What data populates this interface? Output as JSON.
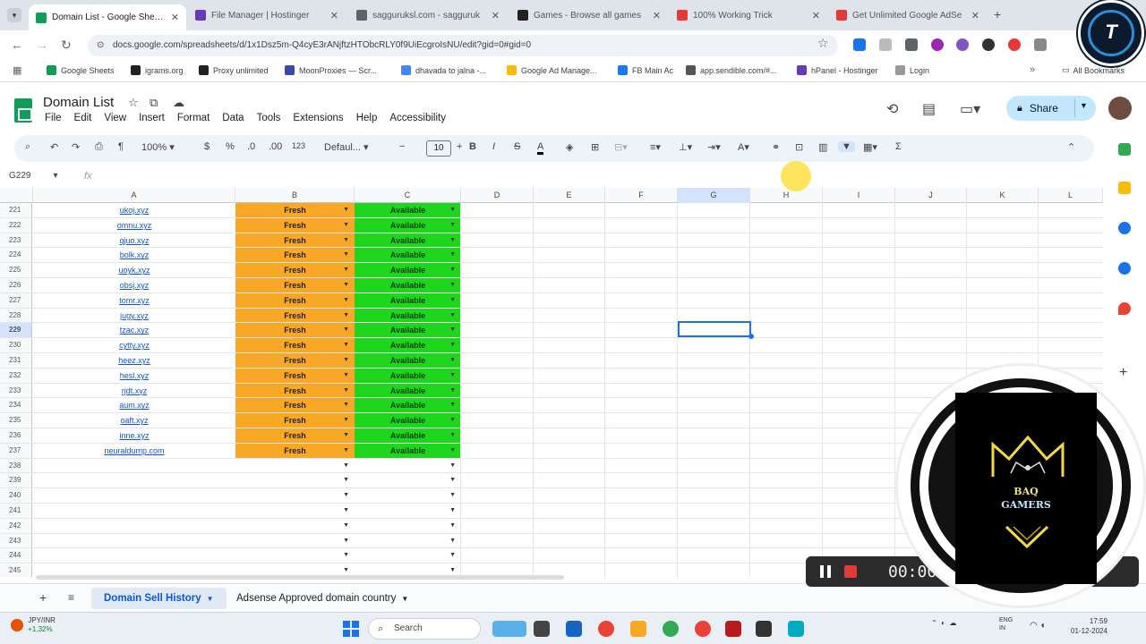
{
  "browser": {
    "tabs": [
      {
        "title": "Domain List - Google Sheets",
        "color": "#0f9d58",
        "active": true
      },
      {
        "title": "File Manager | Hostinger",
        "color": "#673ab7",
        "active": false
      },
      {
        "title": "sagguruksl.com - sagguruk",
        "color": "#5f6368",
        "active": false
      },
      {
        "title": "Games - Browse all games",
        "color": "#222222",
        "active": false
      },
      {
        "title": "100% Working Trick",
        "color": "#e53935",
        "active": false
      },
      {
        "title": "Get Unlimited Google AdSe",
        "color": "#e53935",
        "active": false
      }
    ],
    "url": "docs.google.com/spreadsheets/d/1x1Dsz5m-Q4cyE3rANjftzHTObcRLY0f9UiEcgroIsNU/edit?gid=0#gid=0",
    "bookmarks": [
      {
        "label": "Google Sheets",
        "color": "#0f9d58"
      },
      {
        "label": "igrams.org",
        "color": "#222222"
      },
      {
        "label": "Proxy unlimited",
        "color": "#222222"
      },
      {
        "label": "MoonProxies — Scr...",
        "color": "#3949ab"
      },
      {
        "label": "dhavada to jalna -...",
        "color": "#4285f4"
      },
      {
        "label": "Google Ad Manage...",
        "color": "#fbbc04"
      },
      {
        "label": "FB Main Ac",
        "color": "#1877f2"
      },
      {
        "label": "app.sendible.com/#...",
        "color": "#555555"
      },
      {
        "label": "hPanel - Hostinger",
        "color": "#673ab7"
      },
      {
        "label": "Login",
        "color": "#999999"
      }
    ],
    "all_bookmarks": "All Bookmarks"
  },
  "sheets": {
    "title": "Domain List",
    "menu": [
      "File",
      "Edit",
      "View",
      "Insert",
      "Format",
      "Data",
      "Tools",
      "Extensions",
      "Help",
      "Accessibility"
    ],
    "share_label": "Share",
    "toolbar": {
      "zoom": "100%",
      "currency": "$",
      "percent": "%",
      "dec_dec": ".0",
      "dec_inc": ".00",
      "num_fmt": "123",
      "font": "Defaul...",
      "font_size": "10"
    },
    "name_box": "G229",
    "fx": "fx",
    "columns": [
      "A",
      "B",
      "C",
      "D",
      "E",
      "F",
      "G",
      "H",
      "I",
      "J",
      "K",
      "L"
    ],
    "selected_column": "G",
    "selected_row": "229",
    "rows": [
      {
        "num": "221",
        "domain": "ukoj.xyz",
        "status": "Fresh",
        "avail": "Available"
      },
      {
        "num": "222",
        "domain": "omnu.xyz",
        "status": "Fresh",
        "avail": "Available"
      },
      {
        "num": "223",
        "domain": "qjuo.xyz",
        "status": "Fresh",
        "avail": "Available"
      },
      {
        "num": "224",
        "domain": "bolk.xyz",
        "status": "Fresh",
        "avail": "Available"
      },
      {
        "num": "225",
        "domain": "uoyk.xyz",
        "status": "Fresh",
        "avail": "Available"
      },
      {
        "num": "226",
        "domain": "obsj.xyz",
        "status": "Fresh",
        "avail": "Available"
      },
      {
        "num": "227",
        "domain": "tomr.xyz",
        "status": "Fresh",
        "avail": "Available"
      },
      {
        "num": "228",
        "domain": "jugy.xyz",
        "status": "Fresh",
        "avail": "Available"
      },
      {
        "num": "229",
        "domain": "tzac.xyz",
        "status": "Fresh",
        "avail": "Available"
      },
      {
        "num": "230",
        "domain": "cytty.xyz",
        "status": "Fresh",
        "avail": "Available"
      },
      {
        "num": "231",
        "domain": "heez.xyz",
        "status": "Fresh",
        "avail": "Available"
      },
      {
        "num": "232",
        "domain": "hesl.xyz",
        "status": "Fresh",
        "avail": "Available"
      },
      {
        "num": "233",
        "domain": "rjdt.xyz",
        "status": "Fresh",
        "avail": "Available"
      },
      {
        "num": "234",
        "domain": "aum.xyz",
        "status": "Fresh",
        "avail": "Available"
      },
      {
        "num": "235",
        "domain": "oaft.xyz",
        "status": "Fresh",
        "avail": "Available"
      },
      {
        "num": "236",
        "domain": "inne.xyz",
        "status": "Fresh",
        "avail": "Available"
      },
      {
        "num": "237",
        "domain": "neuraldump.com",
        "status": "Fresh",
        "avail": "Available"
      },
      {
        "num": "238",
        "domain": "",
        "status": "",
        "avail": ""
      },
      {
        "num": "239",
        "domain": "",
        "status": "",
        "avail": ""
      },
      {
        "num": "240",
        "domain": "",
        "status": "",
        "avail": ""
      },
      {
        "num": "241",
        "domain": "",
        "status": "",
        "avail": ""
      },
      {
        "num": "242",
        "domain": "",
        "status": "",
        "avail": ""
      },
      {
        "num": "243",
        "domain": "",
        "status": "",
        "avail": ""
      },
      {
        "num": "244",
        "domain": "",
        "status": "",
        "avail": ""
      },
      {
        "num": "245",
        "domain": "",
        "status": "",
        "avail": ""
      }
    ],
    "sheet_tabs": [
      {
        "label": "Domain Sell History",
        "active": true
      },
      {
        "label": "Adsense Approved domain country",
        "active": false
      }
    ],
    "colors": {
      "fresh": "#f9a825",
      "available": "#1ed61e",
      "selection": "#1a73e8"
    }
  },
  "taskbar": {
    "stock_name": "JPY/INR",
    "stock_change": "+1.32%",
    "search_placeholder": "Search",
    "lang": "ENG",
    "lang2": "IN",
    "time": "17:59",
    "date": "01-12-2024"
  },
  "overlays": {
    "recorder_time": "00:00",
    "badge_line1": "BAQ",
    "badge_line2": "GAMERS"
  }
}
